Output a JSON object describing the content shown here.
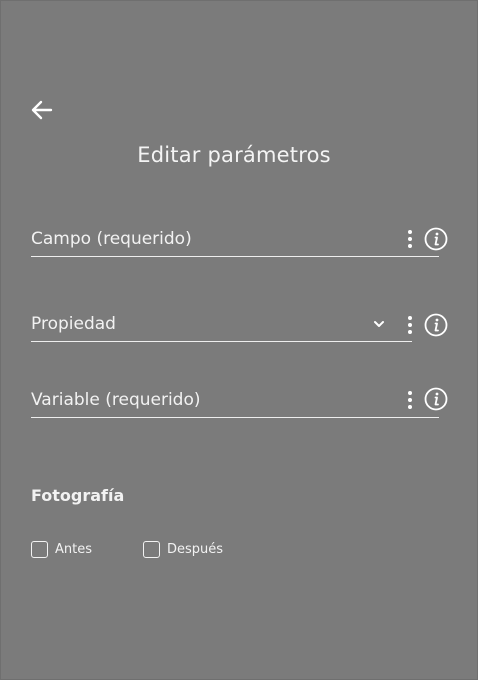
{
  "header": {
    "back_icon": "arrow-left-icon",
    "title": "Editar parámetros"
  },
  "fields": [
    {
      "label": "Campo (requerido)",
      "type": "text",
      "has_more_menu": true,
      "has_info": true
    },
    {
      "label": "Propiedad",
      "type": "select",
      "has_more_menu": true,
      "has_info": true
    },
    {
      "label": "Variable (requerido)",
      "type": "text",
      "has_more_menu": true,
      "has_info": true
    }
  ],
  "photo_section": {
    "title": "Fotografía",
    "options": [
      {
        "label": "Antes",
        "checked": false
      },
      {
        "label": "Después",
        "checked": false
      }
    ]
  },
  "colors": {
    "background": "#7b7b7b",
    "foreground": "#f2f2f2"
  }
}
